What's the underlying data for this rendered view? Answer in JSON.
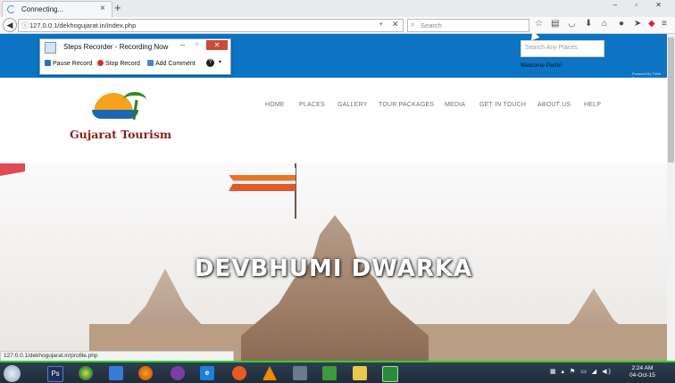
{
  "browser": {
    "tab_title": "Connecting...",
    "tab_close": "×",
    "new_tab": "+",
    "url": "127.0.0.1/dekhogujarat.in/index.php",
    "search_placeholder": "Search",
    "window_controls": "–  ▫  ✕"
  },
  "recorder": {
    "title": "Steps Recorder - Recording Now",
    "pause": "Pause Record",
    "stop": "Stop Record",
    "comment": "Add Comment",
    "help": "?"
  },
  "header": {
    "search_placeholder": "Search Any Places",
    "welcome": "Welcome Parth!",
    "powered": "Powered By Think Tree"
  },
  "logo": {
    "text": "Gujarat Tourism"
  },
  "nav": {
    "items": [
      "HOME",
      "PLACES",
      "GALLERY",
      "TOUR PACKAGES",
      "MEDIA",
      "GET IN TOUCH",
      "ABOUT US",
      "HELP"
    ]
  },
  "hero": {
    "title": "DEVBHUMI DWARKA"
  },
  "status": {
    "link": "127.0.0.1/dekhogujarat.in/profile.php"
  },
  "taskbar": {
    "time": "2:24 AM",
    "date": "04-Oct-15"
  },
  "colors": {
    "header_blue": "#0c74c2",
    "logo_red": "#8a1f1a",
    "taskbar_green": "#2bd22b"
  }
}
